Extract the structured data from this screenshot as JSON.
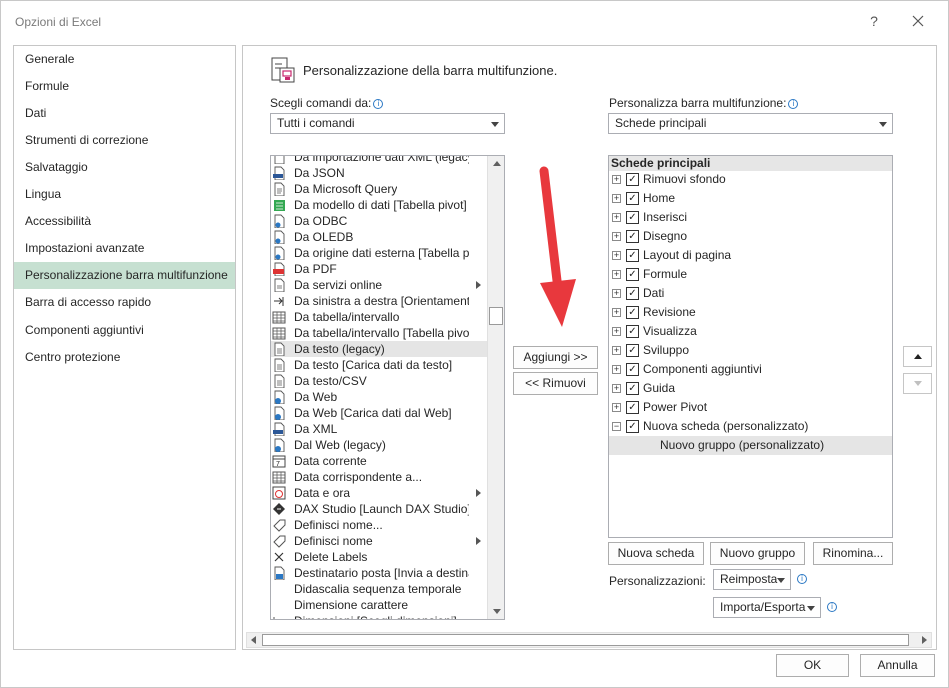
{
  "window": {
    "title": "Opzioni di Excel",
    "help": "?"
  },
  "nav": {
    "items": [
      "Generale",
      "Formule",
      "Dati",
      "Strumenti di correzione",
      "Salvataggio",
      "Lingua",
      "Accessibilità",
      "Impostazioni avanzate",
      "Personalizzazione barra multifunzione",
      "Barra di accesso rapido",
      "Componenti aggiuntivi",
      "Centro protezione"
    ],
    "active": "Personalizzazione barra multifunzione"
  },
  "main": {
    "heading": "Personalizzazione della barra multifunzione.",
    "choose_label": "Scegli comandi da:",
    "choose_value": "Tutti i comandi",
    "customize_label": "Personalizza barra multifunzione:",
    "customize_value": "Schede principali",
    "commands": [
      {
        "label": "Da importazione dati XML (legacy)",
        "icon": "xml-import-icon"
      },
      {
        "label": "Da JSON",
        "icon": "json-file-icon"
      },
      {
        "label": "Da Microsoft Query",
        "icon": "query-file-icon"
      },
      {
        "label": "Da modello di dati [Tabella pivot]",
        "icon": "data-model-icon"
      },
      {
        "label": "Da ODBC",
        "icon": "odbc-icon"
      },
      {
        "label": "Da OLEDB",
        "icon": "oledb-icon"
      },
      {
        "label": "Da origine dati esterna [Tabella pivot]",
        "icon": "external-source-icon"
      },
      {
        "label": "Da PDF",
        "icon": "pdf-icon"
      },
      {
        "label": "Da servizi online",
        "icon": "online-services-icon",
        "submenu": true
      },
      {
        "label": "Da sinistra a destra [Orientamento]",
        "icon": "ltr-icon"
      },
      {
        "label": "Da tabella/intervallo",
        "icon": "table-icon"
      },
      {
        "label": "Da tabella/intervallo [Tabella pivot]",
        "icon": "table-pivot-icon"
      },
      {
        "label": "Da testo (legacy)",
        "icon": "text-file-icon",
        "selected": true
      },
      {
        "label": "Da testo [Carica dati da testo]",
        "icon": "text-file-icon"
      },
      {
        "label": "Da testo/CSV",
        "icon": "text-file-icon"
      },
      {
        "label": "Da Web",
        "icon": "web-icon"
      },
      {
        "label": "Da Web [Carica dati dal Web]",
        "icon": "web-icon"
      },
      {
        "label": "Da XML",
        "icon": "xml-icon"
      },
      {
        "label": "Dal Web (legacy)",
        "icon": "web-icon"
      },
      {
        "label": "Data corrente",
        "icon": "calendar-icon"
      },
      {
        "label": "Data corrispondente a...",
        "icon": "table-icon"
      },
      {
        "label": "Data e ora",
        "icon": "clock-icon",
        "submenu": true
      },
      {
        "label": "DAX Studio [Launch DAX Studio]",
        "icon": "dax-studio-icon"
      },
      {
        "label": "Definisci nome...",
        "icon": "tag-icon"
      },
      {
        "label": "Definisci nome",
        "icon": "tag-icon",
        "submenu": true
      },
      {
        "label": "Delete Labels",
        "icon": "delete-x-icon"
      },
      {
        "label": "Destinatario posta [Invia a destinatario]",
        "icon": "mail-recipient-icon"
      },
      {
        "label": "Didascalia sequenza temporale",
        "icon": "none"
      },
      {
        "label": "Dimensione carattere",
        "icon": "none"
      },
      {
        "label": "Dimensioni [Scegli dimensioni]",
        "icon": "dimensions-icon"
      }
    ],
    "add_button": "Aggiungi >>",
    "remove_button": "<< Rimuovi",
    "tree_header": "Schede principali",
    "tabs": [
      "Rimuovi sfondo",
      "Home",
      "Inserisci",
      "Disegno",
      "Layout di pagina",
      "Formule",
      "Dati",
      "Revisione",
      "Visualizza",
      "Sviluppo",
      "Componenti aggiuntivi",
      "Guida",
      "Power Pivot",
      "Nuova scheda (personalizzato)"
    ],
    "new_group": "Nuovo gruppo (personalizzato)",
    "new_tab_button": "Nuova scheda",
    "new_group_button": "Nuovo gruppo",
    "rename_button": "Rinomina...",
    "customizations_label": "Personalizzazioni:",
    "reset_button": "Reimposta",
    "import_export_button": "Importa/Esporta"
  },
  "footer": {
    "ok": "OK",
    "cancel": "Annulla"
  },
  "colors": {
    "nav_active": "#c6e0d1",
    "arrow": "#e8383d"
  }
}
